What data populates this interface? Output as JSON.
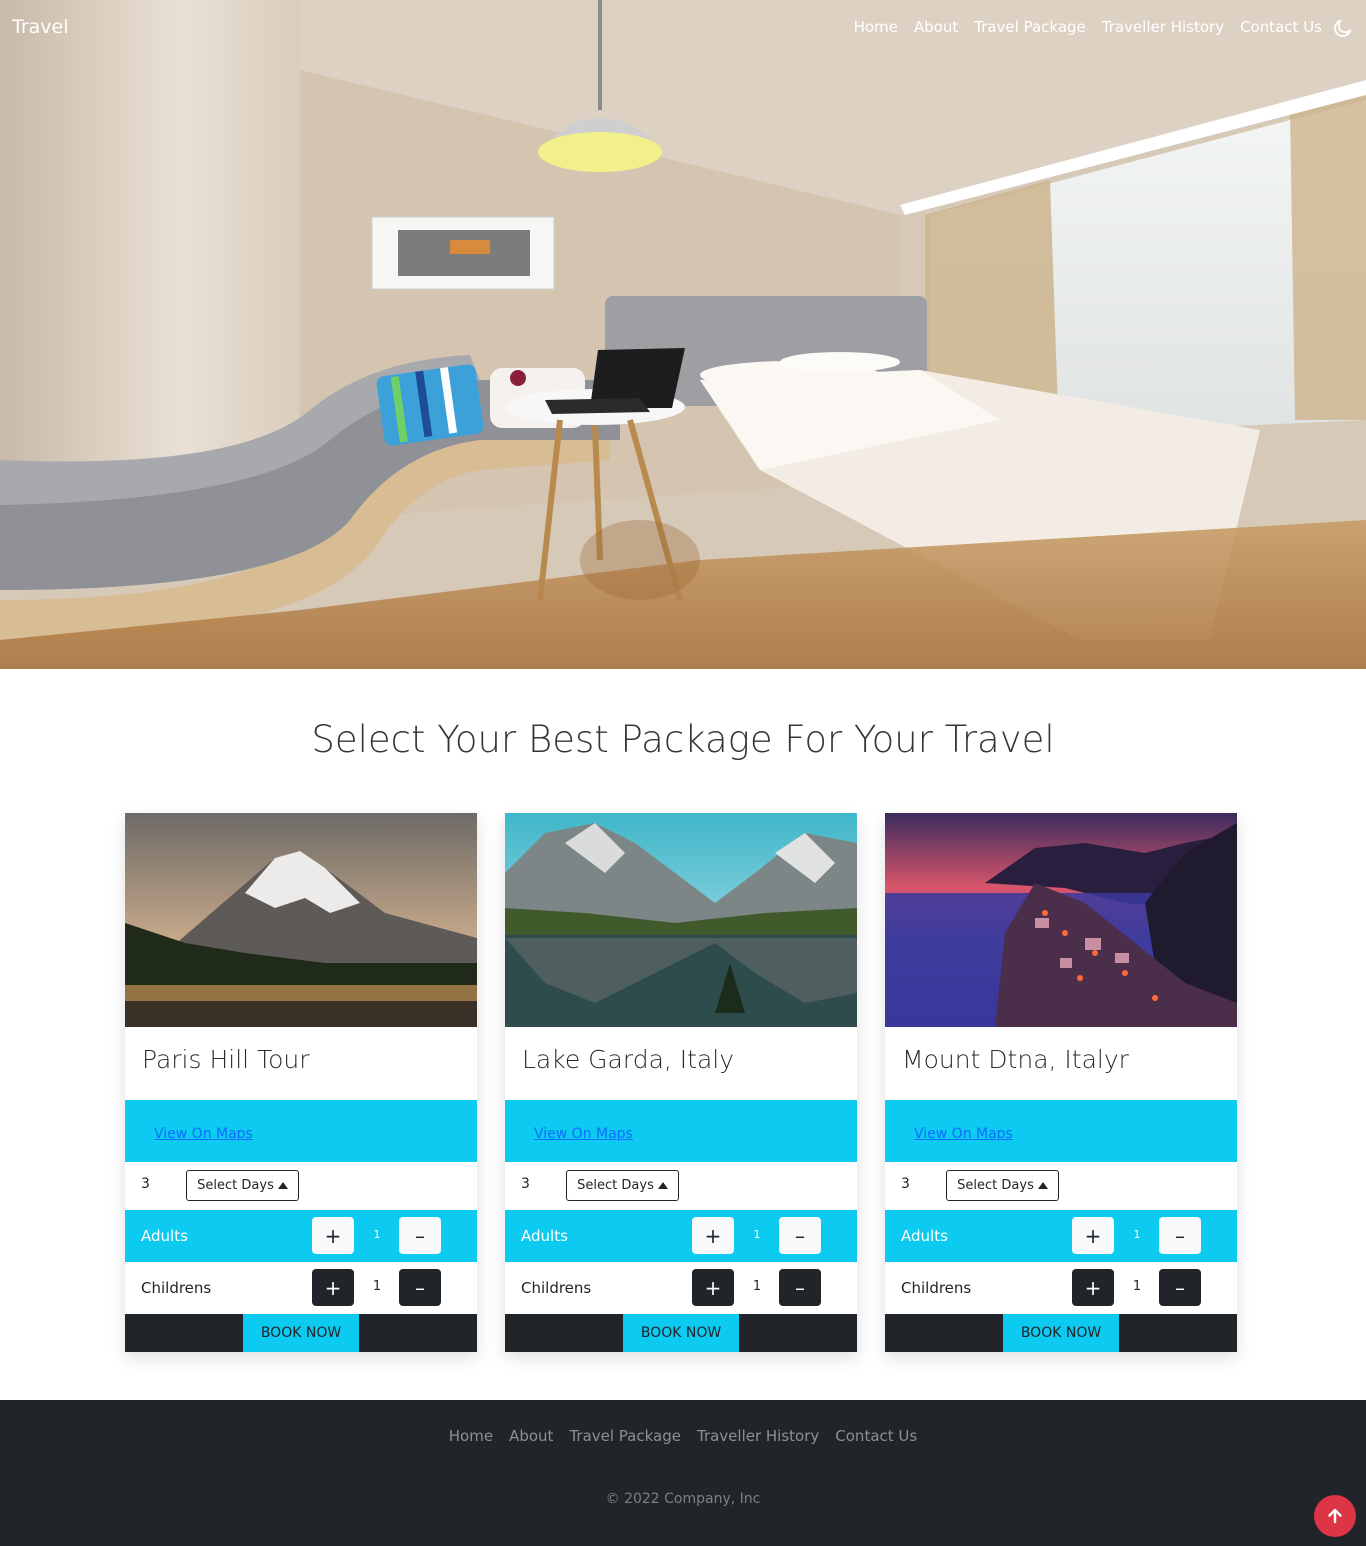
{
  "navbar": {
    "brand": "Travel",
    "links": [
      "Home",
      "About",
      "Travel Package",
      "Traveller History",
      "Contact Us"
    ],
    "theme_icon": "moon-icon"
  },
  "hero": {
    "image": "hotel-room-photo"
  },
  "section": {
    "title": "Select Your Best Package For Your Travel"
  },
  "packages": [
    {
      "title": "Paris Hill Tour",
      "image": "snowy-mountain-forest-photo",
      "maps_label": "View On Maps",
      "days_value": "3",
      "days_select_label": "Select Days",
      "adults_label": "Adults",
      "adults_value": "1",
      "children_label": "Childrens",
      "children_value": "1",
      "book_label": "BOOK NOW"
    },
    {
      "title": "Lake Garda, Italy",
      "image": "mountain-lake-reflection-photo",
      "maps_label": "View On Maps",
      "days_value": "3",
      "days_select_label": "Select Days",
      "adults_label": "Adults",
      "adults_value": "1",
      "children_label": "Childrens",
      "children_value": "1",
      "book_label": "BOOK NOW"
    },
    {
      "title": "Mount Dtna, Italyr",
      "image": "coastal-village-sunset-photo",
      "maps_label": "View On Maps",
      "days_value": "3",
      "days_select_label": "Select Days",
      "adults_label": "Adults",
      "adults_value": "1",
      "children_label": "Childrens",
      "children_value": "1",
      "book_label": "BOOK NOW"
    }
  ],
  "footer": {
    "links": [
      "Home",
      "About",
      "Travel Package",
      "Traveller History",
      "Contact Us"
    ],
    "copyright": "© 2022 Company, Inc"
  },
  "colors": {
    "accent": "#0dcaf0",
    "dark": "#212529",
    "link": "#0d6efd",
    "back_to_top": "#dc3545"
  }
}
